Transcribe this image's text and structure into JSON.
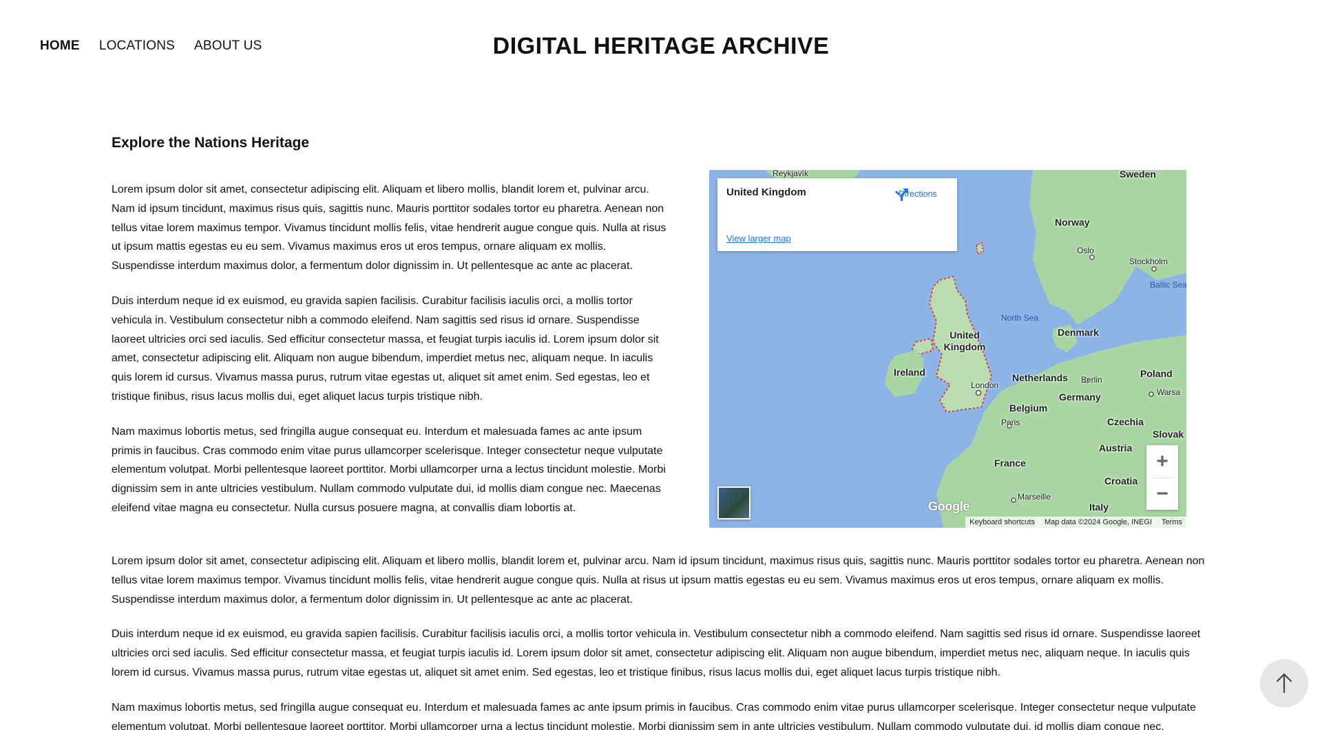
{
  "nav": {
    "items": [
      {
        "label": "HOME",
        "active": true
      },
      {
        "label": "LOCATIONS",
        "active": false
      },
      {
        "label": "ABOUT US",
        "active": false
      }
    ]
  },
  "site_title": "DIGITAL HERITAGE ARCHIVE",
  "section_title": "Explore the Nations Heritage",
  "intro_paragraphs": [
    "Lorem ipsum dolor sit amet, consectetur adipiscing elit. Aliquam et libero mollis, blandit lorem et, pulvinar arcu. Nam id ipsum tincidunt, maximus risus quis, sagittis nunc. Mauris porttitor sodales tortor eu pharetra. Aenean non tellus vitae lorem maximus tempor. Vivamus tincidunt mollis felis, vitae hendrerit augue congue quis. Nulla at risus ut ipsum mattis egestas eu eu sem. Vivamus maximus eros ut eros tempus, ornare aliquam ex mollis. Suspendisse interdum maximus dolor, a fermentum dolor dignissim in. Ut pellentesque ac ante ac placerat.",
    "Duis interdum neque id ex euismod, eu gravida sapien facilisis. Curabitur facilisis iaculis orci, a mollis tortor vehicula in. Vestibulum consectetur nibh a commodo eleifend. Nam sagittis sed risus id ornare. Suspendisse laoreet ultricies orci sed iaculis. Sed efficitur consectetur massa, et feugiat turpis iaculis id. Lorem ipsum dolor sit amet, consectetur adipiscing elit. Aliquam non augue bibendum, imperdiet metus nec, aliquam neque. In iaculis quis lorem id cursus. Vivamus massa purus, rutrum vitae egestas ut, aliquet sit amet enim. Sed egestas, leo et tristique finibus, risus lacus mollis dui, eget aliquet lacus turpis tristique nibh.",
    "Nam maximus lobortis metus, sed fringilla augue consequat eu. Interdum et malesuada fames ac ante ipsum primis in faucibus. Cras commodo enim vitae purus ullamcorper scelerisque. Integer consectetur neque vulputate elementum volutpat. Morbi pellentesque laoreet porttitor. Morbi ullamcorper urna a lectus tincidunt molestie. Morbi dignissim sem in ante ultricies vestibulum. Nullam commodo vulputate dui, id mollis diam congue nec. Maecenas eleifend vitae magna eu consectetur. Nulla cursus posuere magna, at convallis diam lobortis at."
  ],
  "full_paragraphs": [
    "Lorem ipsum dolor sit amet, consectetur adipiscing elit. Aliquam et libero mollis, blandit lorem et, pulvinar arcu. Nam id ipsum tincidunt, maximus risus quis, sagittis nunc. Mauris porttitor sodales tortor eu pharetra. Aenean non tellus vitae lorem maximus tempor. Vivamus tincidunt mollis felis, vitae hendrerit augue congue quis. Nulla at risus ut ipsum mattis egestas eu eu sem. Vivamus maximus eros ut eros tempus, ornare aliquam ex mollis. Suspendisse interdum maximus dolor, a fermentum dolor dignissim in. Ut pellentesque ac ante ac placerat.",
    "Duis interdum neque id ex euismod, eu gravida sapien facilisis. Curabitur facilisis iaculis orci, a mollis tortor vehicula in. Vestibulum consectetur nibh a commodo eleifend. Nam sagittis sed risus id ornare. Suspendisse laoreet ultricies orci sed iaculis. Sed efficitur consectetur massa, et feugiat turpis iaculis id. Lorem ipsum dolor sit amet, consectetur adipiscing elit. Aliquam non augue bibendum, imperdiet metus nec, aliquam neque. In iaculis quis lorem id cursus. Vivamus massa purus, rutrum vitae egestas ut, aliquet sit amet enim. Sed egestas, leo et tristique finibus, risus lacus mollis dui, eget aliquet lacus turpis tristique nibh.",
    "Nam maximus lobortis metus, sed fringilla augue consequat eu. Interdum et malesuada fames ac ante ipsum primis in faucibus. Cras commodo enim vitae purus ullamcorper scelerisque. Integer consectetur neque vulputate elementum volutpat. Morbi pellentesque laoreet porttitor. Morbi ullamcorper urna a lectus tincidunt molestie. Morbi dignissim sem in ante ultricies vestibulum. Nullam commodo vulputate dui, id mollis diam congue nec."
  ],
  "map": {
    "place_name": "United Kingdom",
    "directions_label": "Directions",
    "view_larger_label": "View larger map",
    "zoom_in": "+",
    "zoom_out": "−",
    "google_logo": "Google",
    "attribution": {
      "shortcuts": "Keyboard shortcuts",
      "data": "Map data ©2024 Google, INEGI",
      "terms": "Terms"
    },
    "labels": {
      "reykjavik": "Reykjavík",
      "sweden": "Sweden",
      "norway": "Norway",
      "oslo": "Oslo",
      "stockholm": "Stockholm",
      "baltic_sea": "Baltic Sea",
      "north_sea": "North Sea",
      "united_kingdom": "United Kingdom",
      "denmark": "Denmark",
      "ireland": "Ireland",
      "london": "London",
      "netherlands": "Netherlands",
      "berlin": "Berlin",
      "poland": "Poland",
      "warsaw": "Warsa",
      "germany": "Germany",
      "belgium": "Belgium",
      "paris": "Paris",
      "czechia": "Czechia",
      "slovakia": "Slovak",
      "austria": "Austria",
      "france": "France",
      "croatia": "Croatia",
      "marseille": "Marseille",
      "italy": "Italy"
    },
    "colors": {
      "water": "#8cb4e6",
      "land": "#a8d5a2",
      "border_highlight": "#e53935",
      "link": "#1a73e8"
    }
  }
}
